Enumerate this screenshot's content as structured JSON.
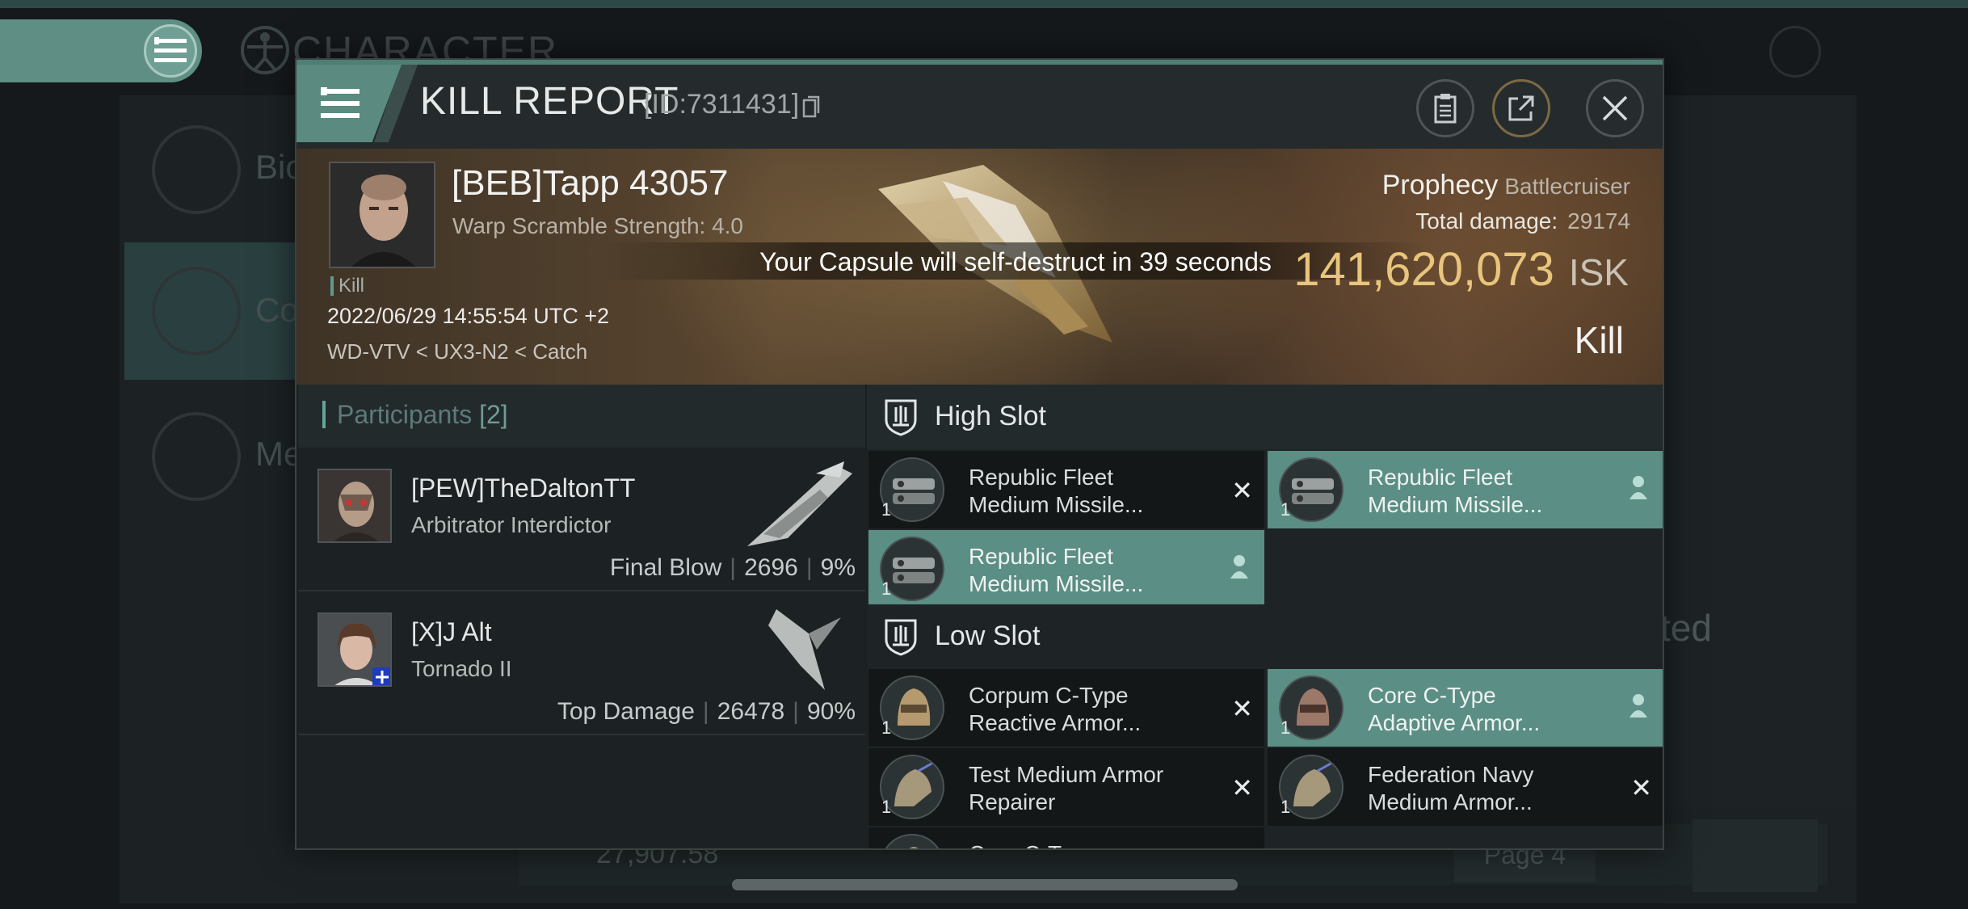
{
  "background": {
    "title": "CHARACTER",
    "menu_rows": [
      {
        "label": "Bio"
      },
      {
        "label": "Co"
      },
      {
        "label": "Me"
      }
    ],
    "right_fragment": "ted",
    "isk_amount": "27,907.58",
    "page_label": "Page 4"
  },
  "modal": {
    "title": "KILL REPORT",
    "report_id": "[ID:7311431]",
    "victim": {
      "name": "[BEB]Tapp 43057",
      "warp_scramble": "Warp Scramble Strength: 4.0",
      "kill_tag": "Kill",
      "datetime": "2022/06/29 14:55:54 UTC +2",
      "route": "WD-VTV < UX3-N2 < Catch"
    },
    "capsule_message": "Your Capsule will self-destruct in 39 seconds",
    "ship": {
      "name": "Prophecy",
      "class": "Battlecruiser",
      "total_damage_label": "Total damage:",
      "total_damage": "29174",
      "isk_value": "141,620,073",
      "isk_unit": "ISK",
      "result": "Kill"
    },
    "participants": {
      "title": "Participants",
      "count": "[2]",
      "rows": [
        {
          "name": "[PEW]TheDaltonTT",
          "ship": "Arbitrator Interdictor",
          "tag": "Final Blow",
          "damage": "2696",
          "percent": "9%"
        },
        {
          "name": "[X]J Alt",
          "ship": "Tornado II",
          "tag": "Top Damage",
          "damage": "26478",
          "percent": "90%"
        }
      ]
    },
    "fitting": {
      "high_slot_title": "High Slot",
      "low_slot_title": "Low Slot",
      "high_modules": [
        {
          "qty": "1",
          "line1": "Republic Fleet",
          "line2": "Medium Missile...",
          "state": "destroyed"
        },
        {
          "qty": "1",
          "line1": "Republic Fleet",
          "line2": "Medium Missile...",
          "state": "dropped"
        },
        {
          "qty": "1",
          "line1": "Republic Fleet",
          "line2": "Medium Missile...",
          "state": "dropped"
        }
      ],
      "low_modules": [
        {
          "qty": "1",
          "line1": "Corpum C-Type",
          "line2": "Reactive Armor...",
          "state": "destroyed"
        },
        {
          "qty": "1",
          "line1": "Core C-Type",
          "line2": "Adaptive Armor...",
          "state": "dropped"
        },
        {
          "qty": "1",
          "line1": "Test Medium Armor",
          "line2": "Repairer",
          "state": "destroyed"
        },
        {
          "qty": "1",
          "line1": "Federation Navy",
          "line2": "Medium Armor...",
          "state": "destroyed"
        },
        {
          "qty": "",
          "line1": "Core C-Type",
          "line2": "",
          "state": "destroyed"
        }
      ]
    }
  }
}
